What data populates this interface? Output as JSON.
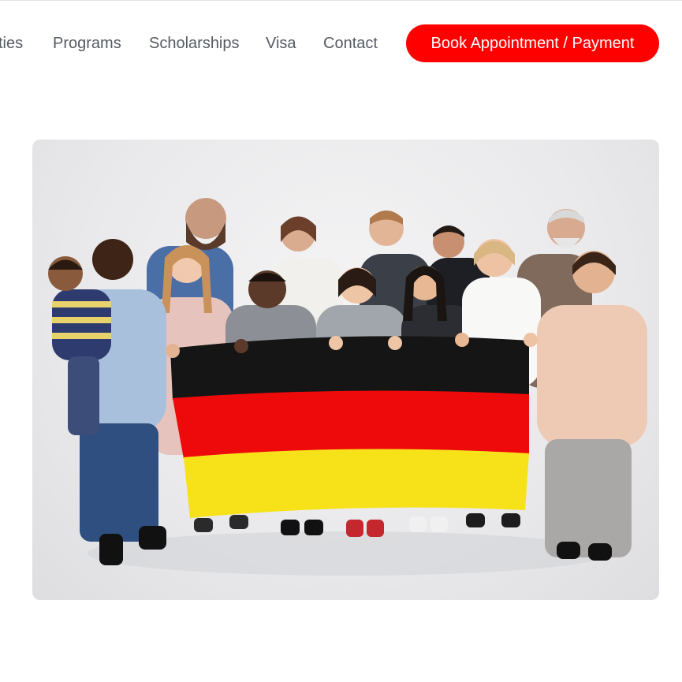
{
  "nav": {
    "items": [
      {
        "label": "ties"
      },
      {
        "label": "Programs"
      },
      {
        "label": "Scholarships"
      },
      {
        "label": "Visa"
      },
      {
        "label": "Contact"
      }
    ],
    "cta_label": "Book Appointment / Payment"
  },
  "colors": {
    "cta": "#ff0000",
    "nav_text": "#555b63",
    "flag_black": "#151515",
    "flag_red": "#ee0a0a",
    "flag_gold": "#f7e21a"
  },
  "hero": {
    "image_alt": "Group of people holding the German flag"
  }
}
